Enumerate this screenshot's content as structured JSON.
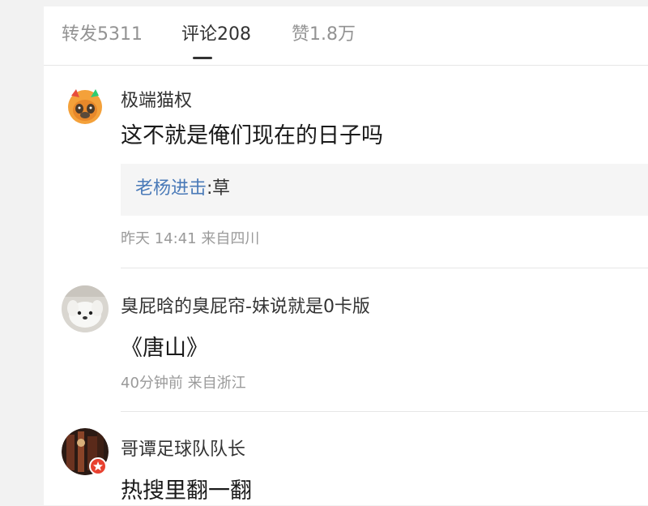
{
  "tabs": {
    "repost": "转发5311",
    "comment": "评论208",
    "like": "赞1.8万"
  },
  "comments": [
    {
      "username": "极端猫权",
      "text": "这不就是俺们现在的日子吗",
      "reply": {
        "author": "老杨进击",
        "separator": ":",
        "text": "草"
      },
      "meta": "昨天 14:41 来自四川",
      "avatar": "orange-cat-avatar"
    },
    {
      "username": "臭屁晗的臭屁帘-妹说就是0卡版",
      "text": "《唐山》",
      "meta": "40分钟前 来自浙江",
      "avatar": "white-dog-avatar"
    },
    {
      "username": "哥谭足球队队长",
      "text": "热搜里翻一翻",
      "avatar": "dark-photo-avatar",
      "badge": "star-badge-icon"
    }
  ],
  "colors": {
    "link": "#4a7ab8",
    "muted": "#9a9a9a",
    "badge": "#e8402f"
  }
}
